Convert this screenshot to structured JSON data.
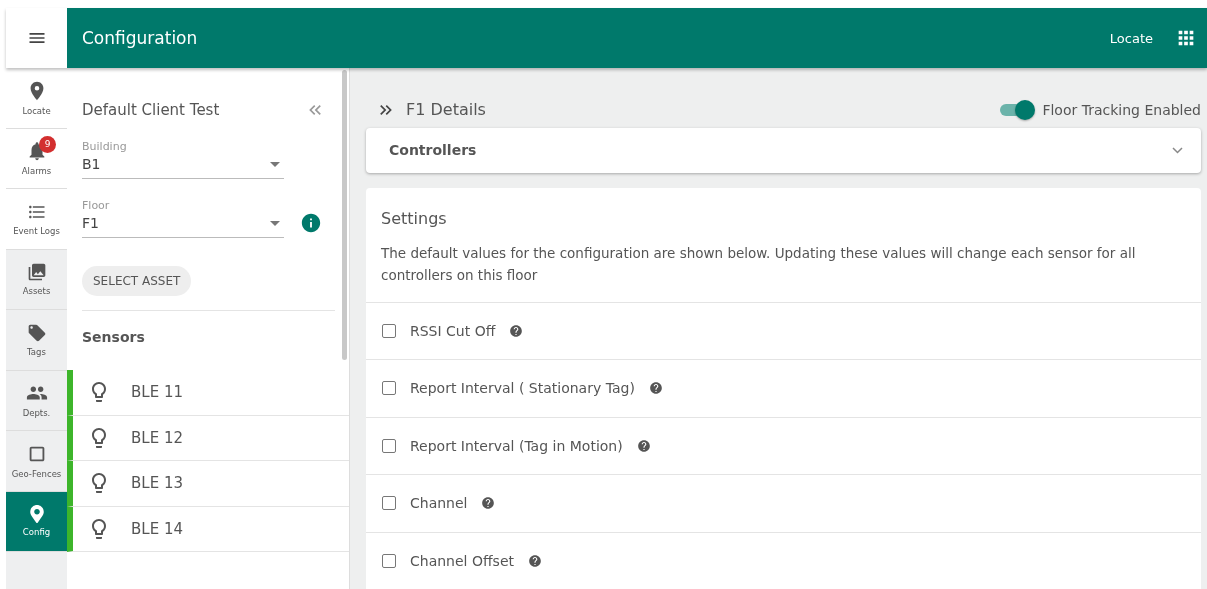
{
  "header": {
    "title": "Configuration",
    "locate": "Locate"
  },
  "nav": [
    {
      "label": "Locate",
      "selected": false,
      "shaded": false
    },
    {
      "label": "Alarms",
      "selected": false,
      "shaded": false,
      "badge": "9"
    },
    {
      "label": "Event Logs",
      "selected": false,
      "shaded": false
    },
    {
      "label": "Assets",
      "selected": false,
      "shaded": true
    },
    {
      "label": "Tags",
      "selected": false,
      "shaded": true
    },
    {
      "label": "Depts.",
      "selected": false,
      "shaded": true
    },
    {
      "label": "Geo-Fences",
      "selected": false,
      "shaded": true
    },
    {
      "label": "Config",
      "selected": true,
      "shaded": true
    }
  ],
  "panel": {
    "client": "Default Client Test",
    "building": {
      "label": "Building",
      "value": "B1"
    },
    "floor": {
      "label": "Floor",
      "value": "F1"
    },
    "select_asset": "SELECT ASSET",
    "sensors_title": "Sensors",
    "sensors": [
      {
        "name": "BLE 11",
        "color": "#3db52a"
      },
      {
        "name": "BLE 12",
        "color": "#3db52a"
      },
      {
        "name": "BLE 13",
        "color": "#3db52a"
      },
      {
        "name": "BLE 14",
        "color": "#3db52a"
      }
    ]
  },
  "details": {
    "title": "F1 Details",
    "tracking": {
      "label": "Floor Tracking Enabled",
      "on": true
    },
    "controllers": {
      "title": "Controllers",
      "expanded": false
    },
    "settings": {
      "title": "Settings",
      "description": "The default values for the configuration are shown below. Updating these values will change each sensor for all controllers on this floor",
      "options": [
        {
          "label": "RSSI Cut Off",
          "checked": false
        },
        {
          "label": "Report Interval ( Stationary Tag)",
          "checked": false
        },
        {
          "label": "Report Interval (Tag in Motion)",
          "checked": false
        },
        {
          "label": "Channel",
          "checked": false
        },
        {
          "label": "Channel Offset",
          "checked": false
        }
      ]
    }
  }
}
